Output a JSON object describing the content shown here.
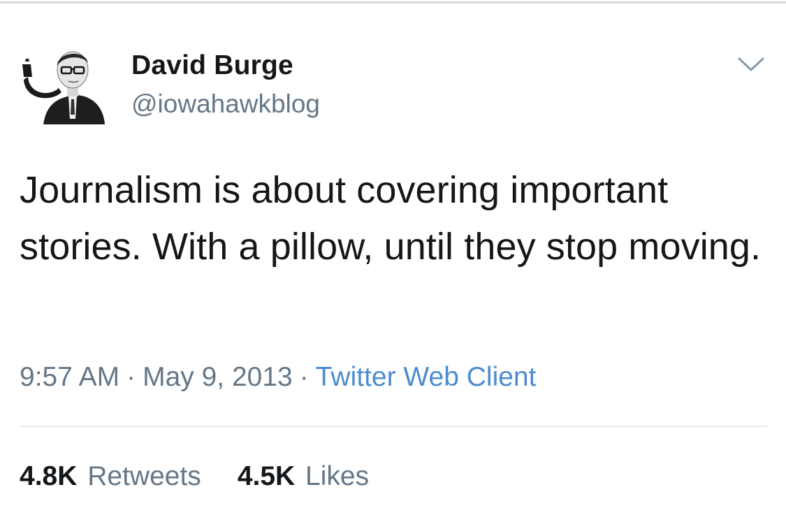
{
  "tweet": {
    "author": {
      "display_name": "David Burge",
      "handle": "@iowahawkblog"
    },
    "text": "Journalism is about covering important stories. With a pillow, until they stop moving.",
    "time": "9:57 AM",
    "separator": "·",
    "date": "May 9, 2013",
    "source": "Twitter Web Client",
    "stats": {
      "retweets_count": "4.8K",
      "retweets_label": "Retweets",
      "likes_count": "4.5K",
      "likes_label": "Likes"
    },
    "menu_icon": "chevron-down-icon"
  },
  "colors": {
    "text_primary": "#14171a",
    "text_secondary": "#657786",
    "link": "#4c8ccf",
    "divider": "#e6ecf0"
  }
}
